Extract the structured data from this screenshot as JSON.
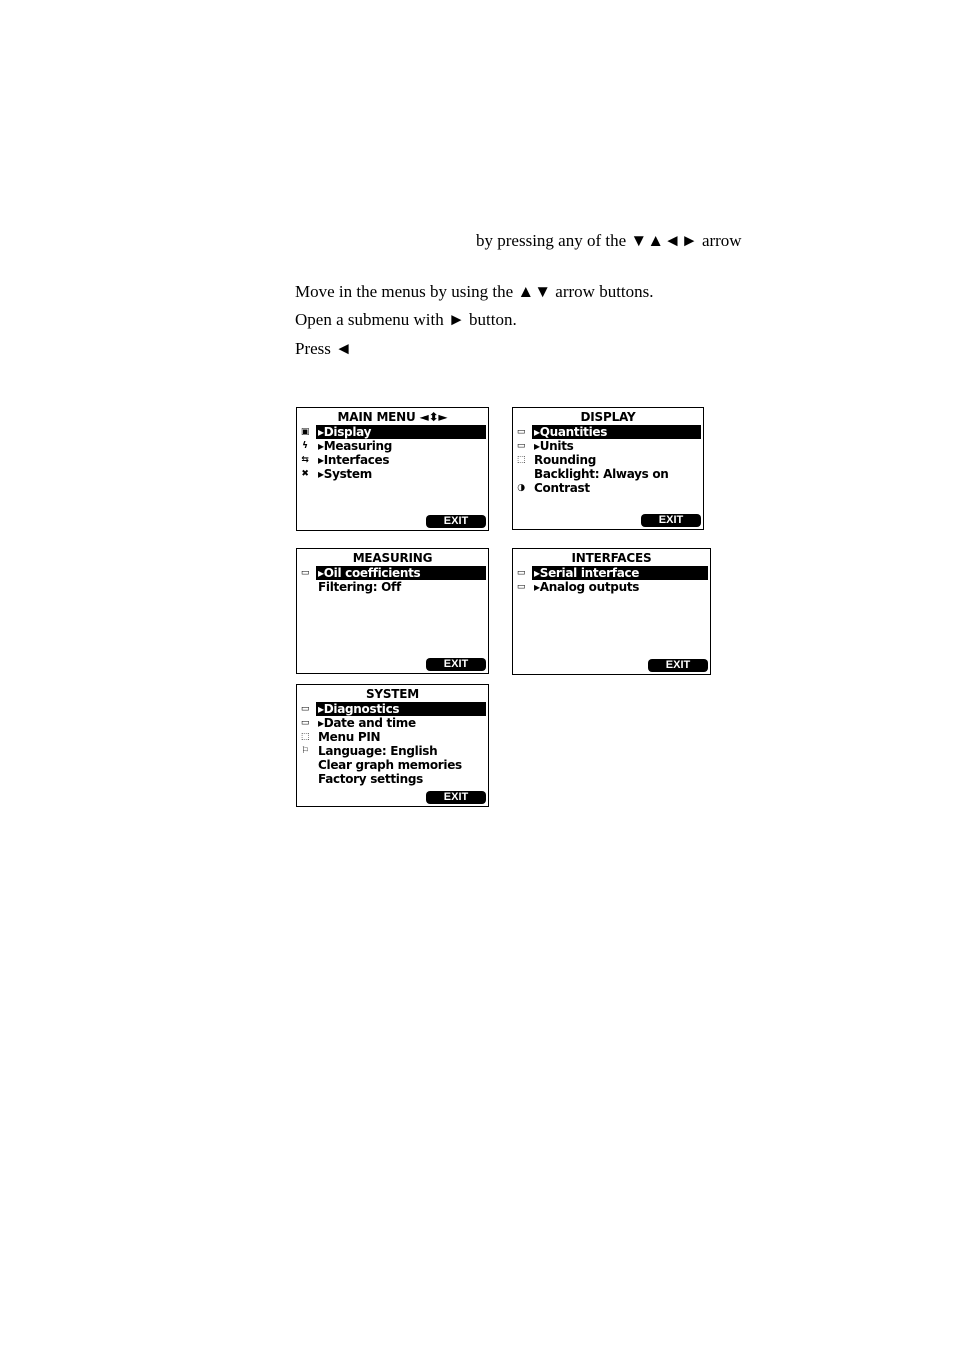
{
  "text": {
    "line1": "by pressing any of the ▼▲◄► arrow",
    "line2": "Move in the menus by using the ▲▼ arrow buttons.",
    "line3": "Open a submenu with ► button.",
    "line4": "Press ◄"
  },
  "screens": {
    "main": {
      "title": "MAIN MENU ◄⬍►",
      "items": [
        {
          "icon": "display-icon",
          "glyph": "▣",
          "label": "▸Display",
          "selected": true
        },
        {
          "icon": "lightning-icon",
          "glyph": "ϟ",
          "label": "▸Measuring"
        },
        {
          "icon": "interfaces-icon",
          "glyph": "⇆",
          "label": "▸Interfaces"
        },
        {
          "icon": "wrench-icon",
          "glyph": "✖",
          "label": "▸System"
        }
      ],
      "exit": "EXIT"
    },
    "display": {
      "title": "DISPLAY",
      "items": [
        {
          "icon": "folder-icon",
          "glyph": "▭",
          "label": "▸Quantities",
          "selected": true
        },
        {
          "icon": "folder-icon",
          "glyph": "▭",
          "label": "▸Units"
        },
        {
          "icon": "dotted-box-icon",
          "glyph": "⬚",
          "label": "Rounding"
        },
        {
          "icon": "",
          "glyph": "",
          "label": "Backlight: Always on"
        },
        {
          "icon": "contrast-icon",
          "glyph": "◑",
          "label": "Contrast"
        }
      ],
      "exit": "EXIT"
    },
    "measuring": {
      "title": "MEASURING",
      "items": [
        {
          "icon": "folder-icon",
          "glyph": "▭",
          "label": "▸Oil coefficients",
          "selected": true
        },
        {
          "icon": "",
          "glyph": "",
          "label": "Filtering: Off"
        }
      ],
      "exit": "EXIT"
    },
    "interfaces": {
      "title": "INTERFACES",
      "items": [
        {
          "icon": "folder-icon",
          "glyph": "▭",
          "label": "▸Serial interface",
          "selected": true
        },
        {
          "icon": "folder-icon",
          "glyph": "▭",
          "label": "▸Analog outputs"
        }
      ],
      "exit": "EXIT"
    },
    "system": {
      "title": "SYSTEM",
      "items": [
        {
          "icon": "folder-icon",
          "glyph": "▭",
          "label": "▸Diagnostics",
          "selected": true
        },
        {
          "icon": "folder-icon",
          "glyph": "▭",
          "label": "▸Date and time"
        },
        {
          "icon": "dotted-box-icon",
          "glyph": "⬚",
          "label": "Menu PIN"
        },
        {
          "icon": "flag-icon",
          "glyph": "⚐",
          "label": "Language: English"
        },
        {
          "icon": "",
          "glyph": "",
          "label": "Clear graph memories"
        },
        {
          "icon": "",
          "glyph": "",
          "label": "Factory settings"
        }
      ],
      "exit": "EXIT"
    }
  }
}
